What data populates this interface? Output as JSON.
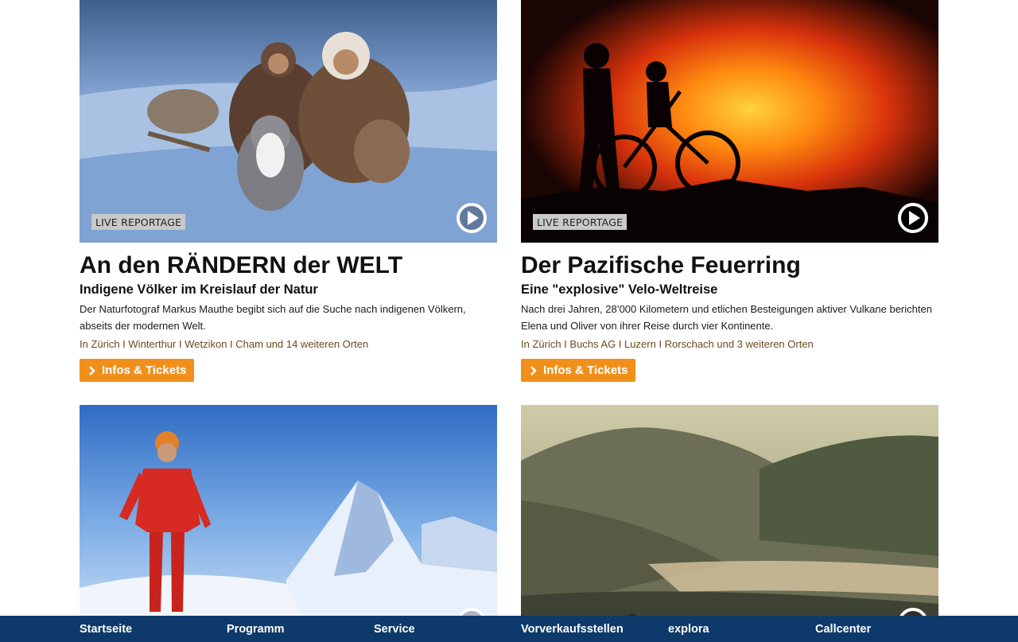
{
  "cards": [
    {
      "badge": "LIVE REPORTAGE",
      "title": "An den RÄNDERN der WELT",
      "subtitle": "Indigene Völker im Kreislauf der Natur",
      "description": "Der Naturfotograf Markus Mauthe begibt sich auf die Suche nach indigenen Völkern, abseits der modernen Welt.",
      "locations": "In Zürich I Winterthur I Wetzikon I Cham und 14 weiteren Orten",
      "button": "Infos & Tickets",
      "icon": "play-circle-icon"
    },
    {
      "badge": "LIVE REPORTAGE",
      "title": "Der Pazifische Feuerring",
      "subtitle": "Eine \"explosive\" Velo-Weltreise",
      "description": "Nach drei Jahren, 28’000 Kilometern und etlichen Besteigungen aktiver Vulkane berichten Elena und Oliver von ihrer Reise durch vier Kontinente.",
      "locations": "In Zürich I Buchs AG I Luzern I Rorschach und 3 weiteren Orten",
      "button": "Infos & Tickets",
      "icon": "play-circle-icon"
    },
    {
      "icon": "play-circle-icon"
    },
    {
      "icon": "play-circle-icon"
    }
  ],
  "colors": {
    "button": "#f0901b",
    "footer": "#0e3a6b",
    "locations": "#6b4a1e",
    "badge": "#c9c9c9"
  },
  "footer": {
    "items": [
      "Startseite",
      "Programm",
      "Service",
      "Vorverkaufsstellen",
      "explora",
      "Callcenter"
    ]
  }
}
